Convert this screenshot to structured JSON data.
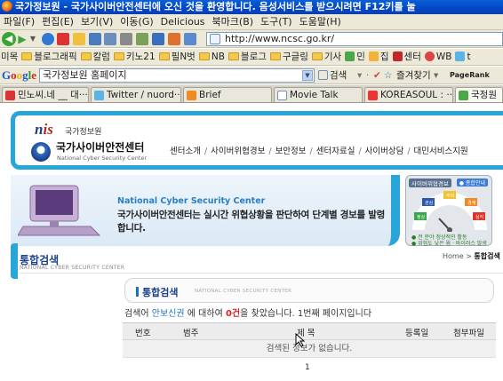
{
  "window": {
    "title": "국가정보원 - 국가사이버안전센터에 오신 것을 환영합니다. 음성서비스를 받으시려면 F12키를 눌"
  },
  "menu": {
    "items": [
      "파일(F)",
      "편집(E)",
      "보기(V)",
      "이동(G)",
      "Delicious",
      "북마크(B)",
      "도구(T)",
      "도움말(H)"
    ]
  },
  "nav": {
    "url": "http://www.ncsc.go.kr/",
    "back_icon": "back-arrow-icon",
    "forward_icon": "forward-arrow-icon"
  },
  "bookmarks": {
    "items": [
      "미목",
      "블로그래픽",
      "칼럼",
      "키노21",
      "필N벗",
      "NB",
      "블로그",
      "구글링",
      "기사",
      "민",
      "집",
      "센터",
      "WB",
      "t"
    ]
  },
  "google": {
    "logo_letters": [
      "G",
      "o",
      "o",
      "g",
      "l",
      "e"
    ],
    "search_value": "국가정보원 홈페이지",
    "search_label": "검색",
    "favorites_label": "즐겨찾기",
    "pagerank_label": "PageRank"
  },
  "tabs": [
    {
      "label": "민노씨.네 __ 대···"
    },
    {
      "label": "Twitter / nuord···"
    },
    {
      "label": "Brief"
    },
    {
      "label": "Movie Talk"
    },
    {
      "label": "KOREASOUL : ···"
    },
    {
      "label": "국정원 "
    }
  ],
  "site": {
    "nis_prefix": "n",
    "nis_suffix": "is",
    "nis_label": "국가정보원",
    "center_name": "국가사이버안전센터",
    "center_eng": "National Cyber Security Center",
    "nav": [
      "센터소개",
      "사이버위협경보",
      "보안정보",
      "센터자료실",
      "사이버상담",
      "대민서비스지원"
    ],
    "banner_title": "National Cyber Security Center",
    "banner_text": "국가사이버안전센터는 실시간 위협상황을 판단하여 단계별 경보를 발령합니다.",
    "status_head": "사이버위협경보",
    "status_button": "● 종합안내",
    "gauge_labels": [
      "관심",
      "주의",
      "경계",
      "심각",
      "정상"
    ],
    "status_notes": [
      "● 전 분야 정상적인 활동",
      "● 위험도 낮은 웜 · 바이러스 발생"
    ]
  },
  "section": {
    "title": "통합검색",
    "eng": "NATIONAL CYBER SECURITY CENTER",
    "breadcrumb_home": "Home",
    "breadcrumb_sep": ">",
    "breadcrumb_current": "통합검색"
  },
  "results": {
    "title": "통합검색",
    "eng": "NATIONAL CYBER SECURITY CENTER",
    "summary_prefix": "검색어",
    "keyword": "안보신권",
    "summary_mid": "에 대하여",
    "count": "0건",
    "summary_suffix": "을 찾았습니다. 1번째 페이지입니다",
    "columns": [
      "번호",
      "범주",
      "제 목",
      "등록일",
      "첨부파일"
    ],
    "empty_message": "검색된 정보가 없습니다.",
    "page": "1"
  }
}
